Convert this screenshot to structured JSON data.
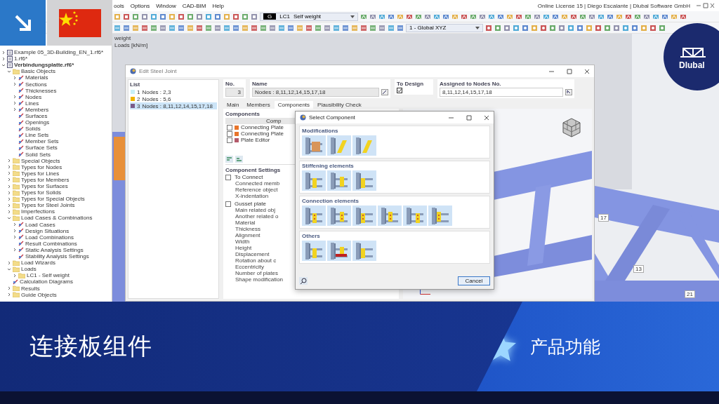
{
  "menu": [
    "ools",
    "Options",
    "Window",
    "CAD-BIM",
    "Help"
  ],
  "license_text": "Online License 15 | Diego Escalante | Dlubal Software GmbH",
  "toolbar": {
    "load_case": {
      "tag": "G",
      "code": "LC1",
      "name": "Self weight"
    },
    "coordinate_system": "1 - Global XYZ"
  },
  "navigator": {
    "tree": [
      {
        "label": "Example 05_3D-Building_EN_1.rf6*",
        "kind": "file",
        "expanded": false
      },
      {
        "label": "1.rf6*",
        "kind": "file",
        "expanded": false
      },
      {
        "label": "Verbindungsplatte.rf6*",
        "kind": "file",
        "expanded": true,
        "children": [
          {
            "label": "Basic Objects",
            "kind": "folder",
            "expanded": true,
            "children": [
              {
                "label": "Materials",
                "kind": "object",
                "expanded": false
              },
              {
                "label": "Sections",
                "kind": "object",
                "expanded": false
              },
              {
                "label": "Thicknesses",
                "kind": "object"
              },
              {
                "label": "Nodes",
                "kind": "object",
                "expanded": false
              },
              {
                "label": "Lines",
                "kind": "object",
                "expanded": false
              },
              {
                "label": "Members",
                "kind": "object",
                "expanded": false
              },
              {
                "label": "Surfaces",
                "kind": "object"
              },
              {
                "label": "Openings",
                "kind": "object"
              },
              {
                "label": "Solids",
                "kind": "object"
              },
              {
                "label": "Line Sets",
                "kind": "object"
              },
              {
                "label": "Member Sets",
                "kind": "object"
              },
              {
                "label": "Surface Sets",
                "kind": "object"
              },
              {
                "label": "Solid Sets",
                "kind": "object"
              }
            ]
          },
          {
            "label": "Special Objects",
            "kind": "folder",
            "expanded": false
          },
          {
            "label": "Types for Nodes",
            "kind": "folder",
            "expanded": false
          },
          {
            "label": "Types for Lines",
            "kind": "folder",
            "expanded": false
          },
          {
            "label": "Types for Members",
            "kind": "folder",
            "expanded": false
          },
          {
            "label": "Types for Surfaces",
            "kind": "folder",
            "expanded": false
          },
          {
            "label": "Types for Solids",
            "kind": "folder",
            "expanded": false
          },
          {
            "label": "Types for Special Objects",
            "kind": "folder",
            "expanded": false
          },
          {
            "label": "Types for Steel Joints",
            "kind": "folder",
            "expanded": false
          },
          {
            "label": "Imperfections",
            "kind": "folder",
            "expanded": false
          },
          {
            "label": "Load Cases & Combinations",
            "kind": "folder",
            "expanded": true,
            "children": [
              {
                "label": "Load Cases",
                "kind": "object",
                "expanded": false
              },
              {
                "label": "Design Situations",
                "kind": "object",
                "expanded": false
              },
              {
                "label": "Load Combinations",
                "kind": "object",
                "expanded": false
              },
              {
                "label": "Result Combinations",
                "kind": "object"
              },
              {
                "label": "Static Analysis Settings",
                "kind": "object",
                "expanded": false
              },
              {
                "label": "Stability Analysis Settings",
                "kind": "object"
              }
            ]
          },
          {
            "label": "Load Wizards",
            "kind": "folder",
            "expanded": false
          },
          {
            "label": "Loads",
            "kind": "folder",
            "expanded": true,
            "children": [
              {
                "label": "LC1 - Self weight",
                "kind": "folder",
                "expanded": false
              }
            ]
          },
          {
            "label": "Calculation Diagrams",
            "kind": "object"
          },
          {
            "label": "Results",
            "kind": "folder",
            "expanded": false
          },
          {
            "label": "Guide Objects",
            "kind": "folder",
            "expanded": false
          }
        ]
      }
    ]
  },
  "viewport": {
    "info": [
      "weight",
      "Loads [kN/m]"
    ],
    "member_labels": [
      "17",
      "13",
      "21"
    ]
  },
  "edit_dialog": {
    "title": "Edit Steel Joint",
    "list_label": "List",
    "list": [
      {
        "number": "1",
        "label": "Nodes : 2,3",
        "color": "#c8f0f8",
        "selected": false
      },
      {
        "number": "2",
        "label": "Nodes : 5,6",
        "color": "#f0b400",
        "selected": false
      },
      {
        "number": "3",
        "label": "Nodes : 8,11,12,14,15,17,18",
        "color": "#7a5c8a",
        "selected": true
      }
    ],
    "no_label": "No.",
    "no_value": "3",
    "name_label": "Name",
    "name_value": "Nodes : 8,11,12,14,15,17,18",
    "to_design_label": "To Design",
    "to_design_checked": true,
    "assigned_label": "Assigned to Nodes No.",
    "assigned_value": "8,11,12,14,15,17,18",
    "tabs": [
      {
        "label": "Main",
        "selected": false
      },
      {
        "label": "Members",
        "selected": false
      },
      {
        "label": "Components",
        "selected": true
      },
      {
        "label": "Plausibility Check",
        "selected": false
      }
    ],
    "components": {
      "title": "Components",
      "column": "Comp",
      "rows": [
        {
          "label": "Connecting Plate",
          "color": "#e8742a",
          "checked": false
        },
        {
          "label": "Connecting Plate",
          "color": "#e8742a",
          "checked": false
        },
        {
          "label": "Plate Editor",
          "color": "#b45a6a",
          "checked": false
        }
      ]
    },
    "settings": {
      "title": "Component Settings",
      "groups": [
        {
          "label": "To Connect",
          "checked": false,
          "items": [
            "Connected memb",
            "Reference object",
            "X-indentation"
          ]
        },
        {
          "label": "Gusset plate",
          "checked": false,
          "items": [
            "Main related obj",
            "Another related o",
            "Material",
            "Thickness",
            "Alignment",
            "Width",
            "Height",
            "Displacement",
            "Rotation about c",
            "Eccentricity",
            "Number of plates",
            "Shape modification"
          ]
        }
      ]
    }
  },
  "select_dialog": {
    "title": "Select Component",
    "sections": [
      {
        "title": "Modifications"
      },
      {
        "title": "Stiffening elements"
      },
      {
        "title": "Connection elements"
      },
      {
        "title": "Others"
      }
    ],
    "cancel": "Cancel"
  },
  "logo": {
    "text": "Dlubal"
  },
  "banner": {
    "title": "连接板组件",
    "tagline": "产品功能"
  }
}
